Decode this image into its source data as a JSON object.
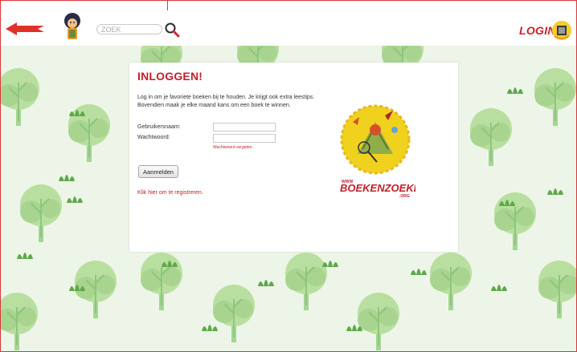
{
  "header": {
    "search_placeholder": "ZOEK",
    "login_label": "LOGIN"
  },
  "login_card": {
    "title": "INLOGGEN!",
    "intro_line1": "Log in om je favoriete boeken bij te houden. Je krijgt ook extra leestips.",
    "intro_line2": "Bovendien maak je elke maand kans om een boek te winnen.",
    "username_label": "Gebruikersnaam:",
    "username_value": "",
    "password_label": "Wachtwoord:",
    "password_value": "",
    "forgot_link": "Wachtwoord vergeten.",
    "submit_label": "Aanmelden",
    "register_link": "Klik hier om te registreren."
  },
  "logo": {
    "www": "WWW",
    "name": "BOEKENZOEKER",
    "tld": ".ORG"
  },
  "colors": {
    "brand_red": "#c41f2b",
    "background_green": "#ecf5e7",
    "tree_green": "#9ccf8a",
    "logo_yellow": "#f0d21e"
  },
  "icons": {
    "back": "left-arrow-icon",
    "mascot": "mascot-icon",
    "search": "magnifier-icon",
    "login": "login-box-icon"
  }
}
